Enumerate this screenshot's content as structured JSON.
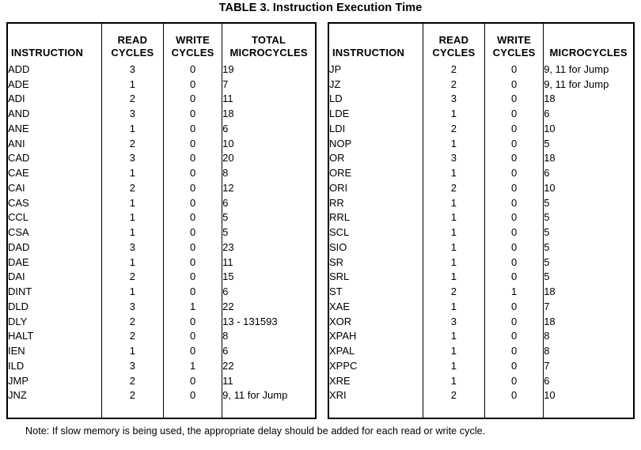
{
  "title": "TABLE 3. Instruction Execution Time",
  "note": "Note: If slow memory is being used, the appropriate delay should be added for each read or write cycle.",
  "colors": {
    "text": "#000000",
    "background": "#ffffff",
    "border": "#000000"
  },
  "tables": [
    {
      "id": "left",
      "headers": [
        {
          "line1": "",
          "line2": "INSTRUCTION"
        },
        {
          "line1": "READ",
          "line2": "CYCLES"
        },
        {
          "line1": "WRITE",
          "line2": "CYCLES"
        },
        {
          "line1": "TOTAL",
          "line2": "MICROCYCLES"
        }
      ],
      "rows": [
        {
          "instruction": "ADD",
          "read": "3",
          "write": "0",
          "microcycles": "19"
        },
        {
          "instruction": "ADE",
          "read": "1",
          "write": "0",
          "microcycles": "7"
        },
        {
          "instruction": "ADI",
          "read": "2",
          "write": "0",
          "microcycles": "11"
        },
        {
          "instruction": "AND",
          "read": "3",
          "write": "0",
          "microcycles": "18"
        },
        {
          "instruction": "ANE",
          "read": "1",
          "write": "0",
          "microcycles": "6"
        },
        {
          "instruction": "ANI",
          "read": "2",
          "write": "0",
          "microcycles": "10"
        },
        {
          "instruction": "CAD",
          "read": "3",
          "write": "0",
          "microcycles": "20"
        },
        {
          "instruction": "CAE",
          "read": "1",
          "write": "0",
          "microcycles": "8"
        },
        {
          "instruction": "CAI",
          "read": "2",
          "write": "0",
          "microcycles": "12"
        },
        {
          "instruction": "CAS",
          "read": "1",
          "write": "0",
          "microcycles": "6"
        },
        {
          "instruction": "CCL",
          "read": "1",
          "write": "0",
          "microcycles": "5"
        },
        {
          "instruction": "CSA",
          "read": "1",
          "write": "0",
          "microcycles": "5"
        },
        {
          "instruction": "DAD",
          "read": "3",
          "write": "0",
          "microcycles": "23"
        },
        {
          "instruction": "DAE",
          "read": "1",
          "write": "0",
          "microcycles": "11"
        },
        {
          "instruction": "DAI",
          "read": "2",
          "write": "0",
          "microcycles": "15"
        },
        {
          "instruction": "DINT",
          "read": "1",
          "write": "0",
          "microcycles": "6"
        },
        {
          "instruction": "DLD",
          "read": "3",
          "write": "1",
          "microcycles": "22"
        },
        {
          "instruction": "DLY",
          "read": "2",
          "write": "0",
          "microcycles": "13 - 131593"
        },
        {
          "instruction": "HALT",
          "read": "2",
          "write": "0",
          "microcycles": "8"
        },
        {
          "instruction": "IEN",
          "read": "1",
          "write": "0",
          "microcycles": "6"
        },
        {
          "instruction": "ILD",
          "read": "3",
          "write": "1",
          "microcycles": "22"
        },
        {
          "instruction": "JMP",
          "read": "2",
          "write": "0",
          "microcycles": "11"
        },
        {
          "instruction": "JNZ",
          "read": "2",
          "write": "0",
          "microcycles": "9, 11 for Jump"
        },
        {
          "instruction": "",
          "read": "",
          "write": "",
          "microcycles": ""
        }
      ]
    },
    {
      "id": "right",
      "headers": [
        {
          "line1": "",
          "line2": "INSTRUCTION"
        },
        {
          "line1": "READ",
          "line2": "CYCLES"
        },
        {
          "line1": "WRITE",
          "line2": "CYCLES"
        },
        {
          "line1": "",
          "line2": "MICROCYCLES"
        }
      ],
      "rows": [
        {
          "instruction": "JP",
          "read": "2",
          "write": "0",
          "microcycles": "9, 11 for Jump"
        },
        {
          "instruction": "JZ",
          "read": "2",
          "write": "0",
          "microcycles": "9, 11 for Jump"
        },
        {
          "instruction": "LD",
          "read": "3",
          "write": "0",
          "microcycles": "18"
        },
        {
          "instruction": "LDE",
          "read": "1",
          "write": "0",
          "microcycles": "6"
        },
        {
          "instruction": "LDI",
          "read": "2",
          "write": "0",
          "microcycles": "10"
        },
        {
          "instruction": "NOP",
          "read": "1",
          "write": "0",
          "microcycles": "5"
        },
        {
          "instruction": "OR",
          "read": "3",
          "write": "0",
          "microcycles": "18"
        },
        {
          "instruction": "ORE",
          "read": "1",
          "write": "0",
          "microcycles": "6"
        },
        {
          "instruction": "ORI",
          "read": "2",
          "write": "0",
          "microcycles": "10"
        },
        {
          "instruction": "RR",
          "read": "1",
          "write": "0",
          "microcycles": "5"
        },
        {
          "instruction": "RRL",
          "read": "1",
          "write": "0",
          "microcycles": "5"
        },
        {
          "instruction": "SCL",
          "read": "1",
          "write": "0",
          "microcycles": "5"
        },
        {
          "instruction": "SIO",
          "read": "1",
          "write": "0",
          "microcycles": "5"
        },
        {
          "instruction": "SR",
          "read": "1",
          "write": "0",
          "microcycles": "5"
        },
        {
          "instruction": "SRL",
          "read": "1",
          "write": "0",
          "microcycles": "5"
        },
        {
          "instruction": "ST",
          "read": "2",
          "write": "1",
          "microcycles": "18"
        },
        {
          "instruction": "XAE",
          "read": "1",
          "write": "0",
          "microcycles": "7"
        },
        {
          "instruction": "XOR",
          "read": "3",
          "write": "0",
          "microcycles": "18"
        },
        {
          "instruction": "XPAH",
          "read": "1",
          "write": "0",
          "microcycles": "8"
        },
        {
          "instruction": "XPAL",
          "read": "1",
          "write": "0",
          "microcycles": "8"
        },
        {
          "instruction": "XPPC",
          "read": "1",
          "write": "0",
          "microcycles": "7"
        },
        {
          "instruction": "XRE",
          "read": "1",
          "write": "0",
          "microcycles": "6"
        },
        {
          "instruction": "XRI",
          "read": "2",
          "write": "0",
          "microcycles": "10"
        },
        {
          "instruction": "",
          "read": "",
          "write": "",
          "microcycles": ""
        }
      ]
    }
  ]
}
